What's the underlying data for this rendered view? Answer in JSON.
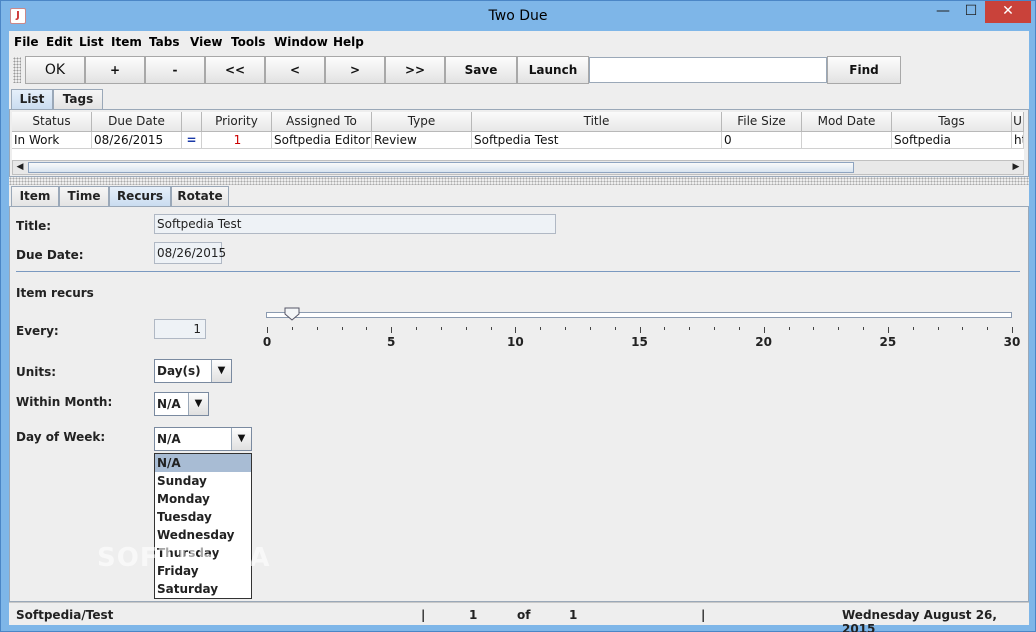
{
  "window": {
    "title": "Two Due",
    "min_glyph": "—",
    "max_glyph": "☐",
    "close_glyph": "✕",
    "icon": "java-cup-icon"
  },
  "menu": [
    "File",
    "Edit",
    "List",
    "Item",
    "Tabs",
    "View",
    "Tools",
    "Window",
    "Help"
  ],
  "toolbar": {
    "ok": "OK",
    "add": "+",
    "remove": "-",
    "first": "<<",
    "prev": "<",
    "next": ">",
    "last": ">>",
    "save": "Save",
    "launch": "Launch",
    "search_value": "",
    "find": "Find"
  },
  "top_tabs": [
    "List",
    "Tags"
  ],
  "table": {
    "columns": [
      "Status",
      "Due Date",
      "",
      "Priority",
      "Assigned To",
      "Type",
      "Title",
      "File Size",
      "Mod Date",
      "Tags",
      "U"
    ],
    "rows": [
      [
        "In Work",
        "08/26/2015",
        "=",
        "1",
        "Softpedia Editor",
        "Review",
        "Softpedia Test",
        "0",
        "",
        "Softpedia",
        "ht"
      ]
    ]
  },
  "bottom_tabs": [
    "Item",
    "Time",
    "Recurs",
    "Rotate"
  ],
  "form": {
    "title_label": "Title:",
    "title_value": "Softpedia Test",
    "due_label": "Due Date:",
    "due_value": "08/26/2015",
    "item_recurs_label": "Item recurs",
    "every_label": "Every:",
    "every_value": "1",
    "slider": {
      "min": 0,
      "max": 30,
      "value": 1,
      "ticks": [
        "0",
        "5",
        "10",
        "15",
        "20",
        "25",
        "30"
      ]
    },
    "units_label": "Units:",
    "units_value": "Day(s)",
    "within_month_label": "Within Month:",
    "within_month_value": "N/A",
    "day_of_week_label": "Day of Week:",
    "day_of_week_value": "N/A",
    "day_of_week_options": [
      "N/A",
      "Sunday",
      "Monday",
      "Tuesday",
      "Wednesday",
      "Thursday",
      "Friday",
      "Saturday"
    ]
  },
  "status": {
    "path": "Softpedia/Test",
    "sep1": "|",
    "current": "1",
    "of": "of",
    "total": "1",
    "sep2": "|",
    "date": "Wednesday August 26, 2015"
  },
  "watermark": "SOFTPEDIA"
}
